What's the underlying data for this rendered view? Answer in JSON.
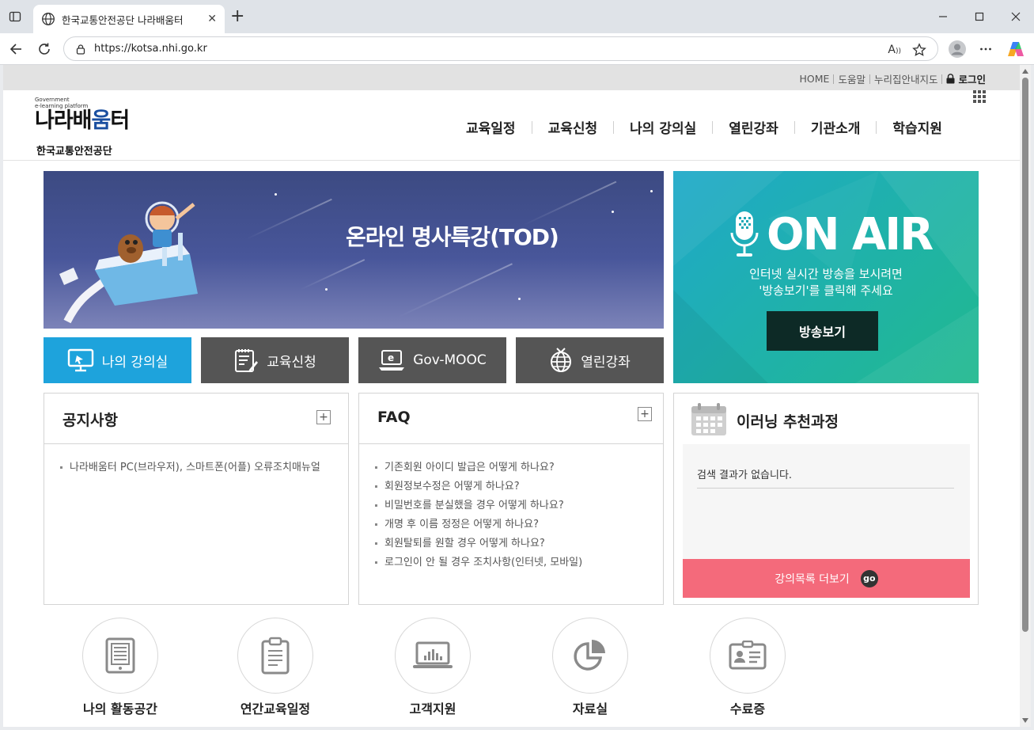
{
  "browser": {
    "tab_title": "한국교통안전공단 나라배움터",
    "url": "https://kotsa.nhi.go.kr"
  },
  "util_links": {
    "home": "HOME",
    "help": "도움말",
    "sitemap": "누리집안내지도",
    "login": "로그인"
  },
  "logo": {
    "line1": "Government",
    "line2": "e-learning platform",
    "name_a": "나라배",
    "name_b": "움",
    "name_c": "터",
    "org": "한국교통안전공단"
  },
  "gnb": [
    "교육일정",
    "교육신청",
    "나의 강의실",
    "열린강좌",
    "기관소개",
    "학습지원"
  ],
  "main_banner": {
    "title": "온라인 명사특강(TOD)"
  },
  "onair": {
    "title": "ON AIR",
    "desc_line1": "인터넷 실시간 방송을 보시려면",
    "desc_line2": "'방송보기'를 클릭해 주세요",
    "button": "방송보기"
  },
  "quick_buttons": [
    {
      "label": "나의 강의실",
      "color": "#1ea3dc"
    },
    {
      "label": "교육신청",
      "color": "#555555"
    },
    {
      "label": "Gov-MOOC",
      "color": "#555555"
    },
    {
      "label": "열린강좌",
      "color": "#555555"
    }
  ],
  "notice": {
    "title": "공지사항",
    "items": [
      "나라배움터 PC(브라우저), 스마트폰(어플) 오류조치매뉴얼"
    ]
  },
  "faq": {
    "title": "FAQ",
    "items": [
      "기존회원 아이디 발급은 어떻게 하나요?",
      "회원정보수정은 어떻게 하나요?",
      "비밀번호를 분실했을 경우 어떻게 하나요?",
      "개명 후 이름 정정은 어떻게 하나요?",
      "회원탈퇴를 원할 경우 어떻게 하나요?",
      "로그인이 안 될 경우 조치사항(인터넷, 모바일)"
    ]
  },
  "recommend": {
    "title": "이러닝 추천과정",
    "empty": "검색 결과가 없습니다.",
    "more": "강의목록 더보기",
    "go": "go"
  },
  "bottom_links": [
    "나의 활동공간",
    "연간교육일정",
    "고객지원",
    "자료실",
    "수료증"
  ]
}
